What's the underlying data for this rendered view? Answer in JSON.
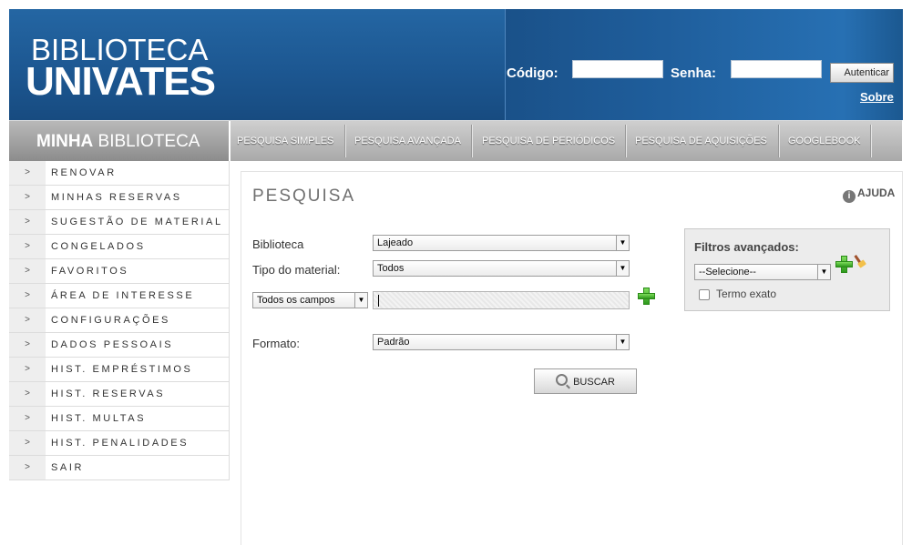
{
  "header": {
    "logo_top": "BIBLIOTECA",
    "logo_bottom": "UNIVATES",
    "codigo_label": "Código:",
    "senha_label": "Senha:",
    "login_button": "Autenticar",
    "sobre_link": "Sobre"
  },
  "nav": {
    "my_library_bold": "MINHA",
    "my_library_rest": " BIBLIOTECA",
    "items": [
      {
        "label": "PESQUISA SIMPLES"
      },
      {
        "label": "PESQUISA AVANÇADA"
      },
      {
        "label": "PESQUISA DE PERIÓDICOS"
      },
      {
        "label": "PESQUISA DE AQUISIÇÕES"
      },
      {
        "label": "GOOGLEBOOK"
      }
    ]
  },
  "sidebar": {
    "arrow": ">",
    "items": [
      {
        "label": "RENOVAR"
      },
      {
        "label": "MINHAS RESERVAS"
      },
      {
        "label": "SUGESTÃO DE MATERIAL"
      },
      {
        "label": "CONGELADOS"
      },
      {
        "label": "FAVORITOS"
      },
      {
        "label": "ÁREA DE INTERESSE"
      },
      {
        "label": "CONFIGURAÇÕES"
      },
      {
        "label": "DADOS PESSOAIS"
      },
      {
        "label": "HIST. EMPRÉSTIMOS"
      },
      {
        "label": "HIST. RESERVAS"
      },
      {
        "label": "HIST. MULTAS"
      },
      {
        "label": "HIST. PENALIDADES"
      },
      {
        "label": "SAIR"
      }
    ]
  },
  "main": {
    "title": "PESQUISA",
    "help_label": "AJUDA",
    "help_icon_glyph": "i",
    "biblioteca_label": "Biblioteca",
    "biblioteca_value": "Lajeado",
    "tipo_label": "Tipo do material:",
    "tipo_value": "Todos",
    "campo_value": "Todos os campos",
    "formato_label": "Formato:",
    "formato_value": "Padrão",
    "search_button": "BUSCAR",
    "select_arrow": "▼"
  },
  "filters": {
    "title": "Filtros avançados:",
    "select_value": "--Selecione--",
    "exact_label": "Termo exato"
  },
  "colors": {
    "header_blue": "#1f5a93",
    "nav_gray": "#a9a9a9",
    "plus_green": "#2f9a1d"
  }
}
